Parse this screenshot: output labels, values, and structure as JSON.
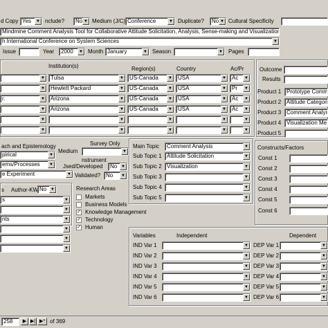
{
  "row1": {
    "hard_copy_label": "d Copy",
    "hard_copy_value": "Yes",
    "include_label": "nclude?",
    "include_value": "No",
    "medium_label": "Medium (J/C)",
    "medium_value": "Conference",
    "duplicate_label": "Duplicate?",
    "duplicate_value": "No",
    "cultural_label": "Cultural Specificity"
  },
  "title_value": "Mindmine Comment Analysis Tool for Collaborative Attitude Solicitation, Analysis, Sense-making and Visualization",
  "journal_value": "h International Conference on System Sciences",
  "issue_row": {
    "issue_label": "Issue",
    "year_label": "Year",
    "year_value": "2000",
    "month_label": "Month",
    "month_value": "January",
    "season_label": "Season",
    "pages_label": "Pages"
  },
  "institutions": {
    "header_inst": "Institution(s)",
    "header_region": "Region(s)",
    "header_country": "Country",
    "header_acpr": "Ac/Pr",
    "rows": [
      {
        "left": "",
        "inst": "Tulsa",
        "region": "US-Canada",
        "country": "USA",
        "acpr": "Ac"
      },
      {
        "left": "",
        "inst": "Hewlett Packard",
        "region": "US-Canada",
        "country": "USA",
        "acpr": "Pr"
      },
      {
        "left": "r.",
        "inst": "Arizona",
        "region": "US-Canada",
        "country": "USA",
        "acpr": "Ac"
      },
      {
        "left": "",
        "inst": "Arizona",
        "region": "US-Canada",
        "country": "USA",
        "acpr": "Ac"
      },
      {
        "left": "",
        "inst": "",
        "region": "",
        "country": "",
        "acpr": ""
      },
      {
        "left": "",
        "inst": "",
        "region": "",
        "country": "",
        "acpr": ""
      }
    ]
  },
  "outcome": {
    "outcome_label": "Outcome",
    "results_label": "Results",
    "products": [
      {
        "label": "Product 1",
        "value": "Prototype Comm"
      },
      {
        "label": "Product 2",
        "value": "Attitude Categoriz"
      },
      {
        "label": "Product 3",
        "value": "Comment Analysi"
      },
      {
        "label": "Product 4",
        "value": "Visualization Me"
      },
      {
        "label": "Product 5",
        "value": ""
      }
    ]
  },
  "method": {
    "epist_label": "ach and Epistemology",
    "epist_value": "pirical",
    "survey_label": "Survey Only",
    "medium_label": "Medium",
    "process_value": "ems/Processes",
    "instrument_label": "nstrument",
    "used_label": "Jsed/Developed",
    "used_value": "No",
    "experiment_value": "e Experiment",
    "validated_label": "Validated?",
    "validated_value": "No"
  },
  "topics": {
    "main_label": "Main Topic",
    "main_value": "Comment Analysis",
    "subs": [
      {
        "label": "Sub Topic 1",
        "value": "Attitude Solicitation"
      },
      {
        "label": "Sub Topic 2",
        "value": "Visualization"
      },
      {
        "label": "Sub Topic 3",
        "value": ""
      },
      {
        "label": "Sub Topic 4",
        "value": ""
      },
      {
        "label": "Sub Topic 5",
        "value": ""
      }
    ]
  },
  "constructs": {
    "header": "Constructs/Factors",
    "items": [
      "Const 1",
      "Const 2",
      "Const 3",
      "Const 4",
      "Const 5",
      "Const 6"
    ]
  },
  "author": {
    "header": "s",
    "author_kw_label": "Author-KW",
    "author_kw_value": "No",
    "rows": [
      "s",
      "",
      "nts",
      "",
      "",
      ""
    ]
  },
  "research": {
    "header": "Research Areas",
    "items": [
      {
        "label": "Markets",
        "checked": ""
      },
      {
        "label": "Business Models",
        "checked": ""
      },
      {
        "label": "Knowledge Management",
        "checked": "✓"
      },
      {
        "label": "Technology",
        "checked": "✓"
      },
      {
        "label": "Human",
        "checked": "✓"
      }
    ]
  },
  "variables": {
    "header": "Variables",
    "indep_label": "Independent",
    "dep_label": "Dependent",
    "ind": [
      "IND Var 1",
      "IND Var 2",
      "IND Var 3",
      "IND Var 4",
      "IND Var 5",
      "IND Var 6"
    ],
    "dep": [
      "DEP Var 1",
      "DEP Var 2",
      "DEP Var 3",
      "DEP Var 4",
      "DEP Var 5",
      "DEP Var 6"
    ]
  },
  "nav": {
    "record_value": "258",
    "of_label": "of 369"
  }
}
